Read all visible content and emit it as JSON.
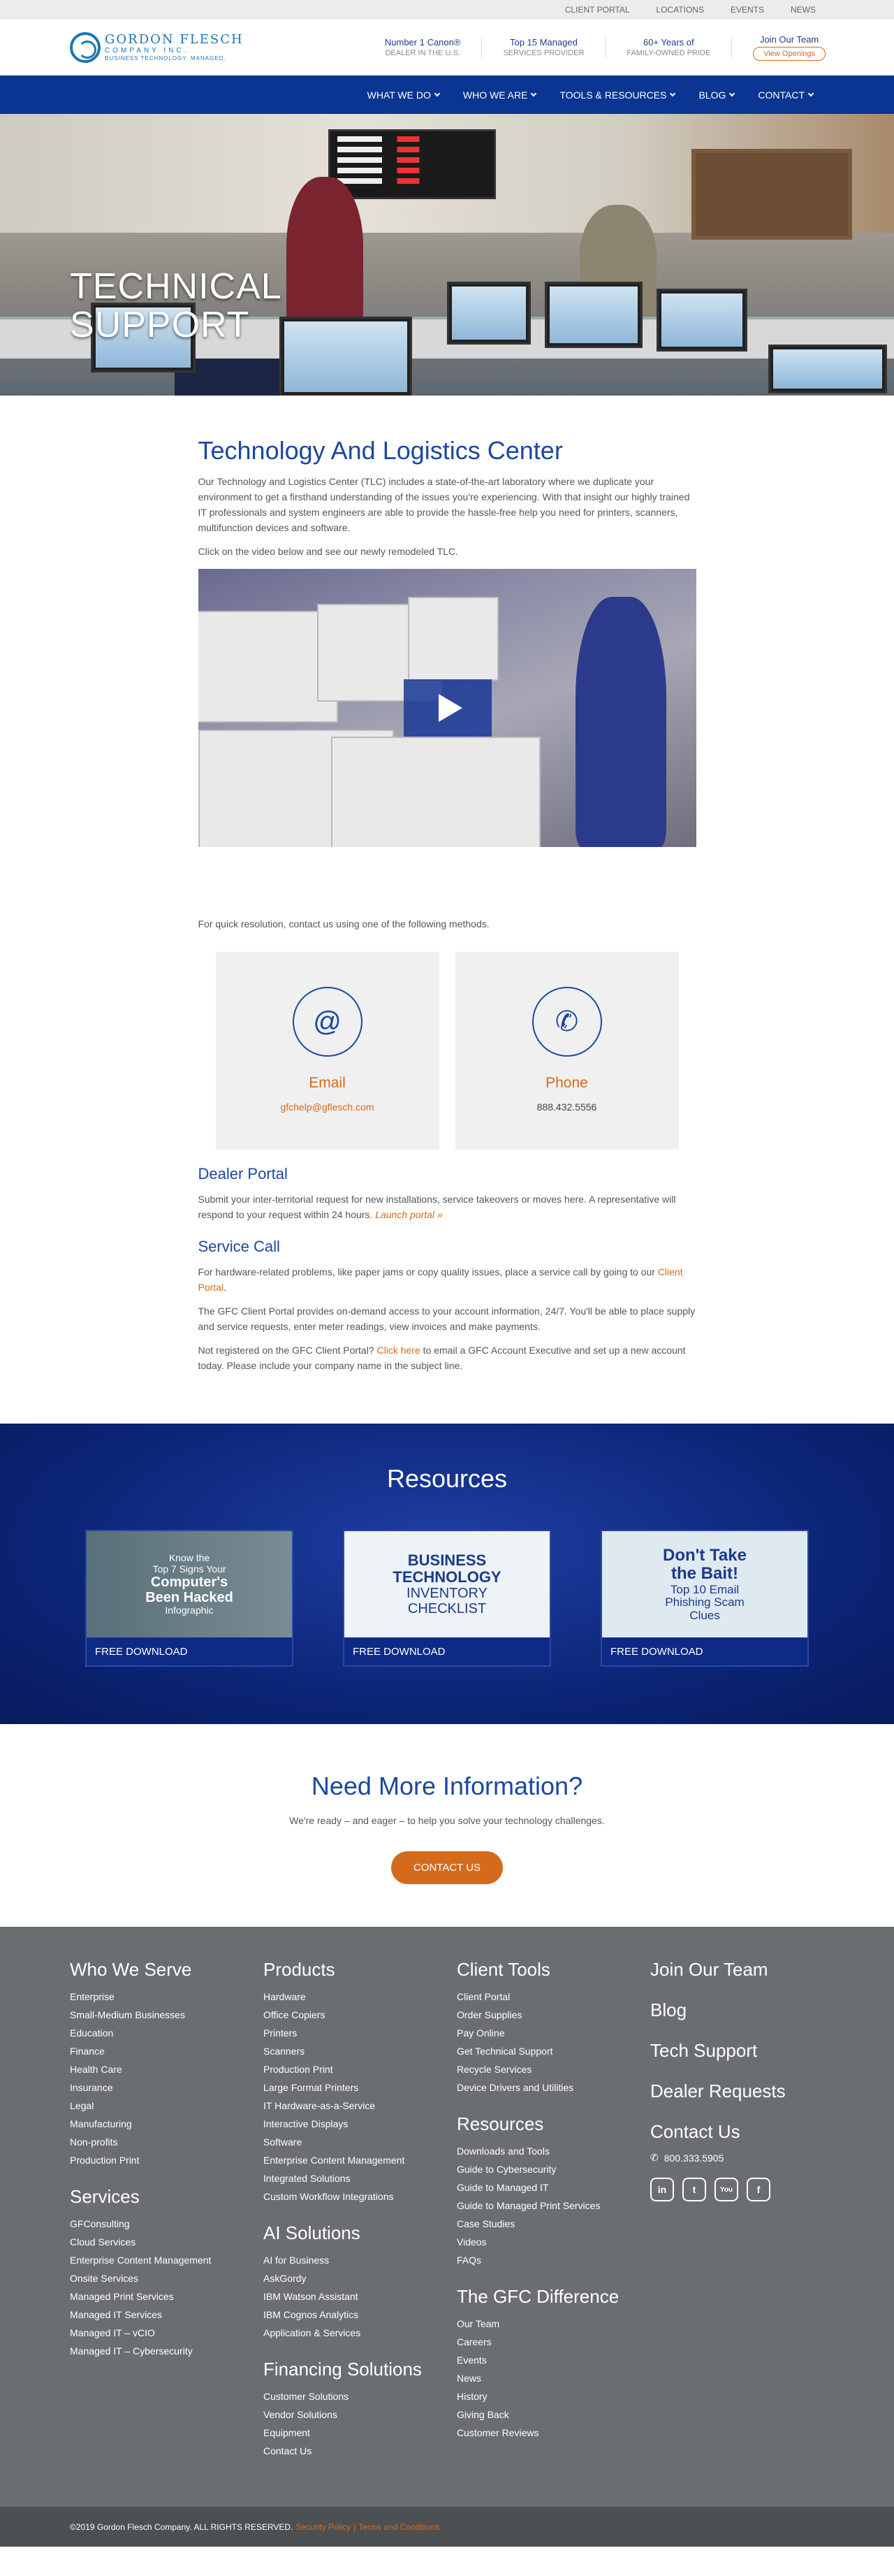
{
  "topbar": {
    "items": [
      "CLIENT PORTAL",
      "LOCATIONS",
      "EVENTS",
      "NEWS"
    ]
  },
  "logo": {
    "name": "GORDON FLESCH",
    "sub": "COMPANY INC.",
    "tag": "BUSINESS TECHNOLOGY. MANAGED."
  },
  "badges": [
    {
      "line1": "Number 1 Canon®",
      "line2": "DEALER IN THE U.S."
    },
    {
      "line1": "Top 15 Managed",
      "line2": "SERVICES PROVIDER"
    },
    {
      "line1": "60+ Years of",
      "line2": "FAMILY-OWNED PRIDE"
    }
  ],
  "join": {
    "title": "Join Our Team",
    "button": "View Openings"
  },
  "nav": [
    "WHAT WE DO",
    "WHO WE ARE",
    "TOOLS & RESOURCES",
    "BLOG",
    "CONTACT"
  ],
  "hero": {
    "title_line1": "TECHNICAL",
    "title_line2": "SUPPORT"
  },
  "tlc": {
    "title": "Technology And Logistics Center",
    "p1": "Our Technology and Logistics Center (TLC) includes a state-of-the-art laboratory where we duplicate your environment to get a firsthand understanding of the issues you're experiencing. With that insight our highly trained IT professionals and system engineers are able to provide the hassle-free help you need for printers, scanners, multifunction devices and software.",
    "p2": "Click on the video below and see our newly remodeled TLC."
  },
  "contact": {
    "intro": "For quick resolution, contact us using one of the following methods.",
    "email": {
      "title": "Email",
      "value": "gfchelp@gflesch.com",
      "icon": "@"
    },
    "phone": {
      "title": "Phone",
      "value": "888.432.5556",
      "icon": "✆"
    }
  },
  "dealer": {
    "title": "Dealer Portal",
    "text": "Submit your inter-territorial request for new installations, service takeovers or moves here. A representative will respond to your request within 24 hours.",
    "link": "Launch portal »"
  },
  "service": {
    "title": "Service Call",
    "p1": "For hardware-related problems, like paper jams or copy quality issues, place a service call by going to our",
    "p1_link": "Client Portal",
    "p1_end": ".",
    "p2": "The GFC Client Portal provides on-demand access to your account information, 24/7. You'll be able to place supply and service requests, enter meter readings, view invoices and make payments.",
    "p3_start": "Not registered on the GFC Client Portal?",
    "p3_link": "Click here",
    "p3_end": "to email a GFC Account Executive and set up a new account today. Please include your company name in the subject line."
  },
  "resources": {
    "title": "Resources",
    "tiles": [
      {
        "l1": "Know the",
        "l2": "Top 7 Signs Your",
        "l3": "Computer's",
        "l4": "Been Hacked",
        "l5": "Infographic",
        "cta": "FREE DOWNLOAD"
      },
      {
        "l1": "BUSINESS",
        "l2": "TECHNOLOGY",
        "l3": "INVENTORY",
        "l4": "CHECKLIST",
        "cta": "FREE DOWNLOAD"
      },
      {
        "l1": "Don't Take",
        "l2": "the Bait!",
        "l3": "Top 10 Email",
        "l4": "Phishing Scam",
        "l5": "Clues",
        "cta": "FREE DOWNLOAD"
      }
    ]
  },
  "more": {
    "title": "Need More Information?",
    "text": "We're ready – and eager – to help you solve your technology challenges.",
    "cta": "CONTACT US"
  },
  "footer": {
    "col1": {
      "h1": "Who We Serve",
      "items1": [
        "Enterprise",
        "Small-Medium Businesses",
        "Education",
        "Finance",
        "Health Care",
        "Insurance",
        "Legal",
        "Manufacturing",
        "Non-profits",
        "Production Print"
      ],
      "h2": "Services",
      "items2": [
        "GFConsulting",
        "Cloud Services",
        "Enterprise Content Management",
        "Onsite Services",
        "Managed Print Services",
        "Managed IT Services",
        "Managed IT – vCIO",
        "Managed IT – Cybersecurity"
      ]
    },
    "col2": {
      "h1": "Products",
      "items1": [
        "Hardware",
        "Office Copiers",
        "Printers",
        "Scanners",
        "Production Print",
        "Large Format Printers",
        "IT Hardware-as-a-Service",
        "Interactive Displays",
        "Software",
        "Enterprise Content Management",
        "Integrated Solutions",
        "Custom Workflow Integrations"
      ],
      "h2": "AI Solutions",
      "items2": [
        "AI for Business",
        "AskGordy",
        "IBM Watson Assistant",
        "IBM Cognos Analytics",
        "Application & Services"
      ],
      "h3": "Financing Solutions",
      "items3": [
        "Customer Solutions",
        "Vendor Solutions",
        "Equipment",
        "Contact Us"
      ]
    },
    "col3": {
      "h1": "Client Tools",
      "items1": [
        "Client Portal",
        "Order Supplies",
        "Pay Online",
        "Get Technical Support",
        "Recycle Services",
        "Device Drivers and Utilities"
      ],
      "h2": "Resources",
      "items2": [
        "Downloads and Tools",
        "Guide to Cybersecurity",
        "Guide to Managed IT",
        "Guide to Managed Print Services",
        "Case Studies",
        "Videos",
        "FAQs"
      ],
      "h3": "The GFC Difference",
      "items3": [
        "Our Team",
        "Careers",
        "Events",
        "News",
        "History",
        "Giving Back",
        "Customer Reviews"
      ]
    },
    "col4": {
      "links": [
        "Join Our Team",
        "Blog",
        "Tech Support",
        "Dealer Requests",
        "Contact Us"
      ],
      "phone": "800.333.5905",
      "social": [
        "in",
        "t",
        "You",
        "f"
      ]
    }
  },
  "copyright": {
    "text": "©2019 Gordon Flesch Company. ALL RIGHTS RESERVED.",
    "privacy": "Security Policy",
    "sep": "|",
    "terms": "Terms and Conditions"
  }
}
